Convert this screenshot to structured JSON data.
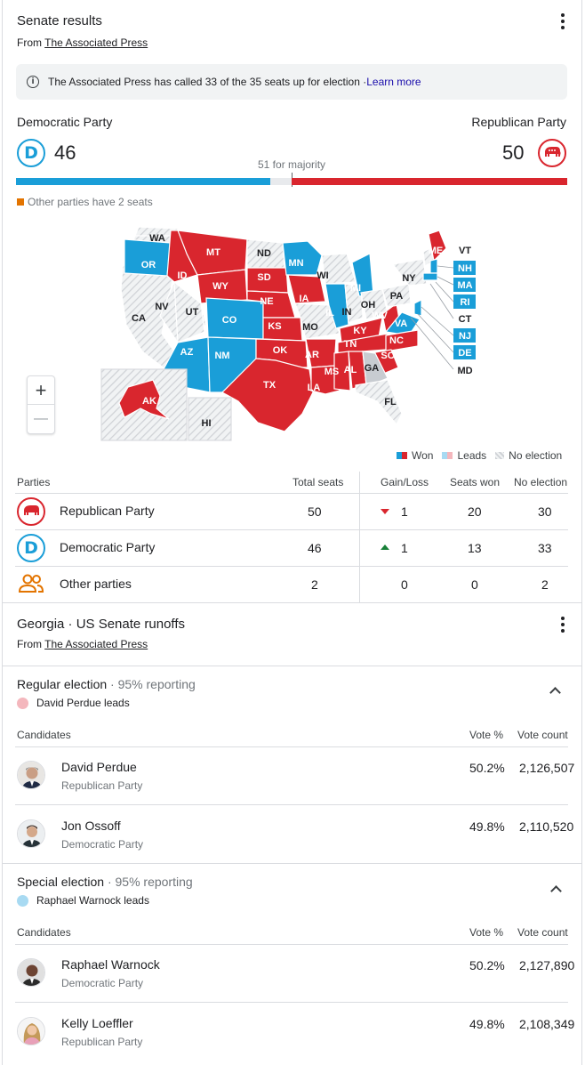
{
  "senate": {
    "title": "Senate results",
    "from_prefix": "From ",
    "source": "The Associated Press",
    "notice": "The Associated Press has called 33 of the 35 seats up for election · ",
    "learn_more": "Learn more",
    "dem_label": "Democratic Party",
    "rep_label": "Republican Party",
    "dem_seats": "46",
    "rep_seats": "50",
    "majority": "51 for majority",
    "other_note": "Other parties have 2 seats",
    "colors": {
      "dem": "#1a9ed8",
      "rep": "#d9262e",
      "other": "#e37400",
      "leads_dem": "#a8daf2",
      "leads_rep": "#f4b7bd",
      "no_election": "#e8eaed"
    },
    "bar": {
      "dem_fraction": 0.46,
      "other_fraction": 0.02,
      "rep_fraction": 0.5
    }
  },
  "map": {
    "states": [
      "WA",
      "MT",
      "ND",
      "MN",
      "OR",
      "ID",
      "SD",
      "WI",
      "MI",
      "WY",
      "NE",
      "IA",
      "IL",
      "IN",
      "OH",
      "PA",
      "NY",
      "CA",
      "NV",
      "UT",
      "CO",
      "KS",
      "MO",
      "KY",
      "WV",
      "VA",
      "AZ",
      "NM",
      "OK",
      "AR",
      "TN",
      "NC",
      "SC",
      "MS",
      "AL",
      "GA",
      "TX",
      "LA",
      "FL",
      "AK",
      "HI",
      "ME",
      "VT",
      "NH",
      "MA",
      "RI",
      "CT",
      "NJ",
      "DE",
      "MD"
    ],
    "zoom_in": "+",
    "zoom_out": "—",
    "legend": {
      "won": "Won",
      "leads": "Leads",
      "no_election": "No election"
    }
  },
  "table": {
    "headers": {
      "parties": "Parties",
      "total": "Total seats",
      "gain": "Gain/Loss",
      "won": "Seats won",
      "none": "No election"
    },
    "rows": [
      {
        "icon": "republican-elephant-icon",
        "party": "Republican Party",
        "total": "50",
        "gain": "1",
        "gain_dir": "down",
        "won": "20",
        "none": "30"
      },
      {
        "icon": "democratic-d-icon",
        "party": "Democratic Party",
        "total": "46",
        "gain": "1",
        "gain_dir": "up",
        "won": "13",
        "none": "33"
      },
      {
        "icon": "people-icon",
        "party": "Other parties",
        "total": "2",
        "gain": "0",
        "gain_dir": "none",
        "won": "0",
        "none": "2"
      }
    ]
  },
  "georgia": {
    "title": "Georgia · US Senate runoffs",
    "from_prefix": "From ",
    "source": "The Associated Press",
    "regular": {
      "title": "Regular election",
      "reporting": " · 95% reporting",
      "leader": "David Perdue leads",
      "headers": {
        "candidates": "Candidates",
        "vote_pct": "Vote %",
        "vote_count": "Vote count"
      },
      "candidates": [
        {
          "name": "David Perdue",
          "party": "Republican Party",
          "pct": "50.2%",
          "count": "2,126,507"
        },
        {
          "name": "Jon Ossoff",
          "party": "Democratic Party",
          "pct": "49.8%",
          "count": "2,110,520"
        }
      ]
    },
    "special": {
      "title": "Special election",
      "reporting": " · 95% reporting",
      "leader": "Raphael Warnock leads",
      "headers": {
        "candidates": "Candidates",
        "vote_pct": "Vote %",
        "vote_count": "Vote count"
      },
      "candidates": [
        {
          "name": "Raphael Warnock",
          "party": "Democratic Party",
          "pct": "50.2%",
          "count": "2,127,890"
        },
        {
          "name": "Kelly Loeffler",
          "party": "Republican Party",
          "pct": "49.8%",
          "count": "2,108,349"
        }
      ]
    }
  }
}
